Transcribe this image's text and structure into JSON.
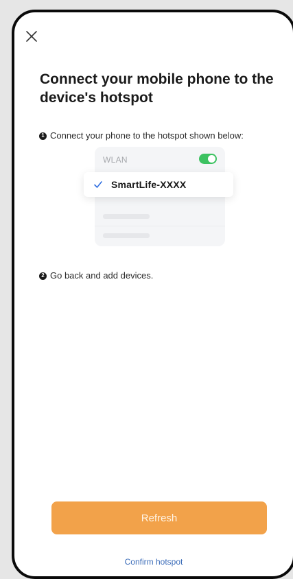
{
  "header": {
    "close_icon": "close-icon"
  },
  "title": "Connect your mobile phone to the device's hotspot",
  "steps": [
    {
      "number": "1",
      "text": "Connect your phone to the hotspot shown below:"
    },
    {
      "number": "2",
      "text": "Go back and add devices."
    }
  ],
  "illustration": {
    "wlan_label": "WLAN",
    "toggle_on": true,
    "selected_network": "SmartLife-XXXX",
    "check_icon": "checkmark-icon"
  },
  "actions": {
    "refresh_label": "Refresh",
    "confirm_label": "Confirm hotspot"
  },
  "colors": {
    "accent": "#f2a24a",
    "link": "#3a6bb8",
    "toggle": "#3cc261",
    "check": "#2f6ee0"
  }
}
